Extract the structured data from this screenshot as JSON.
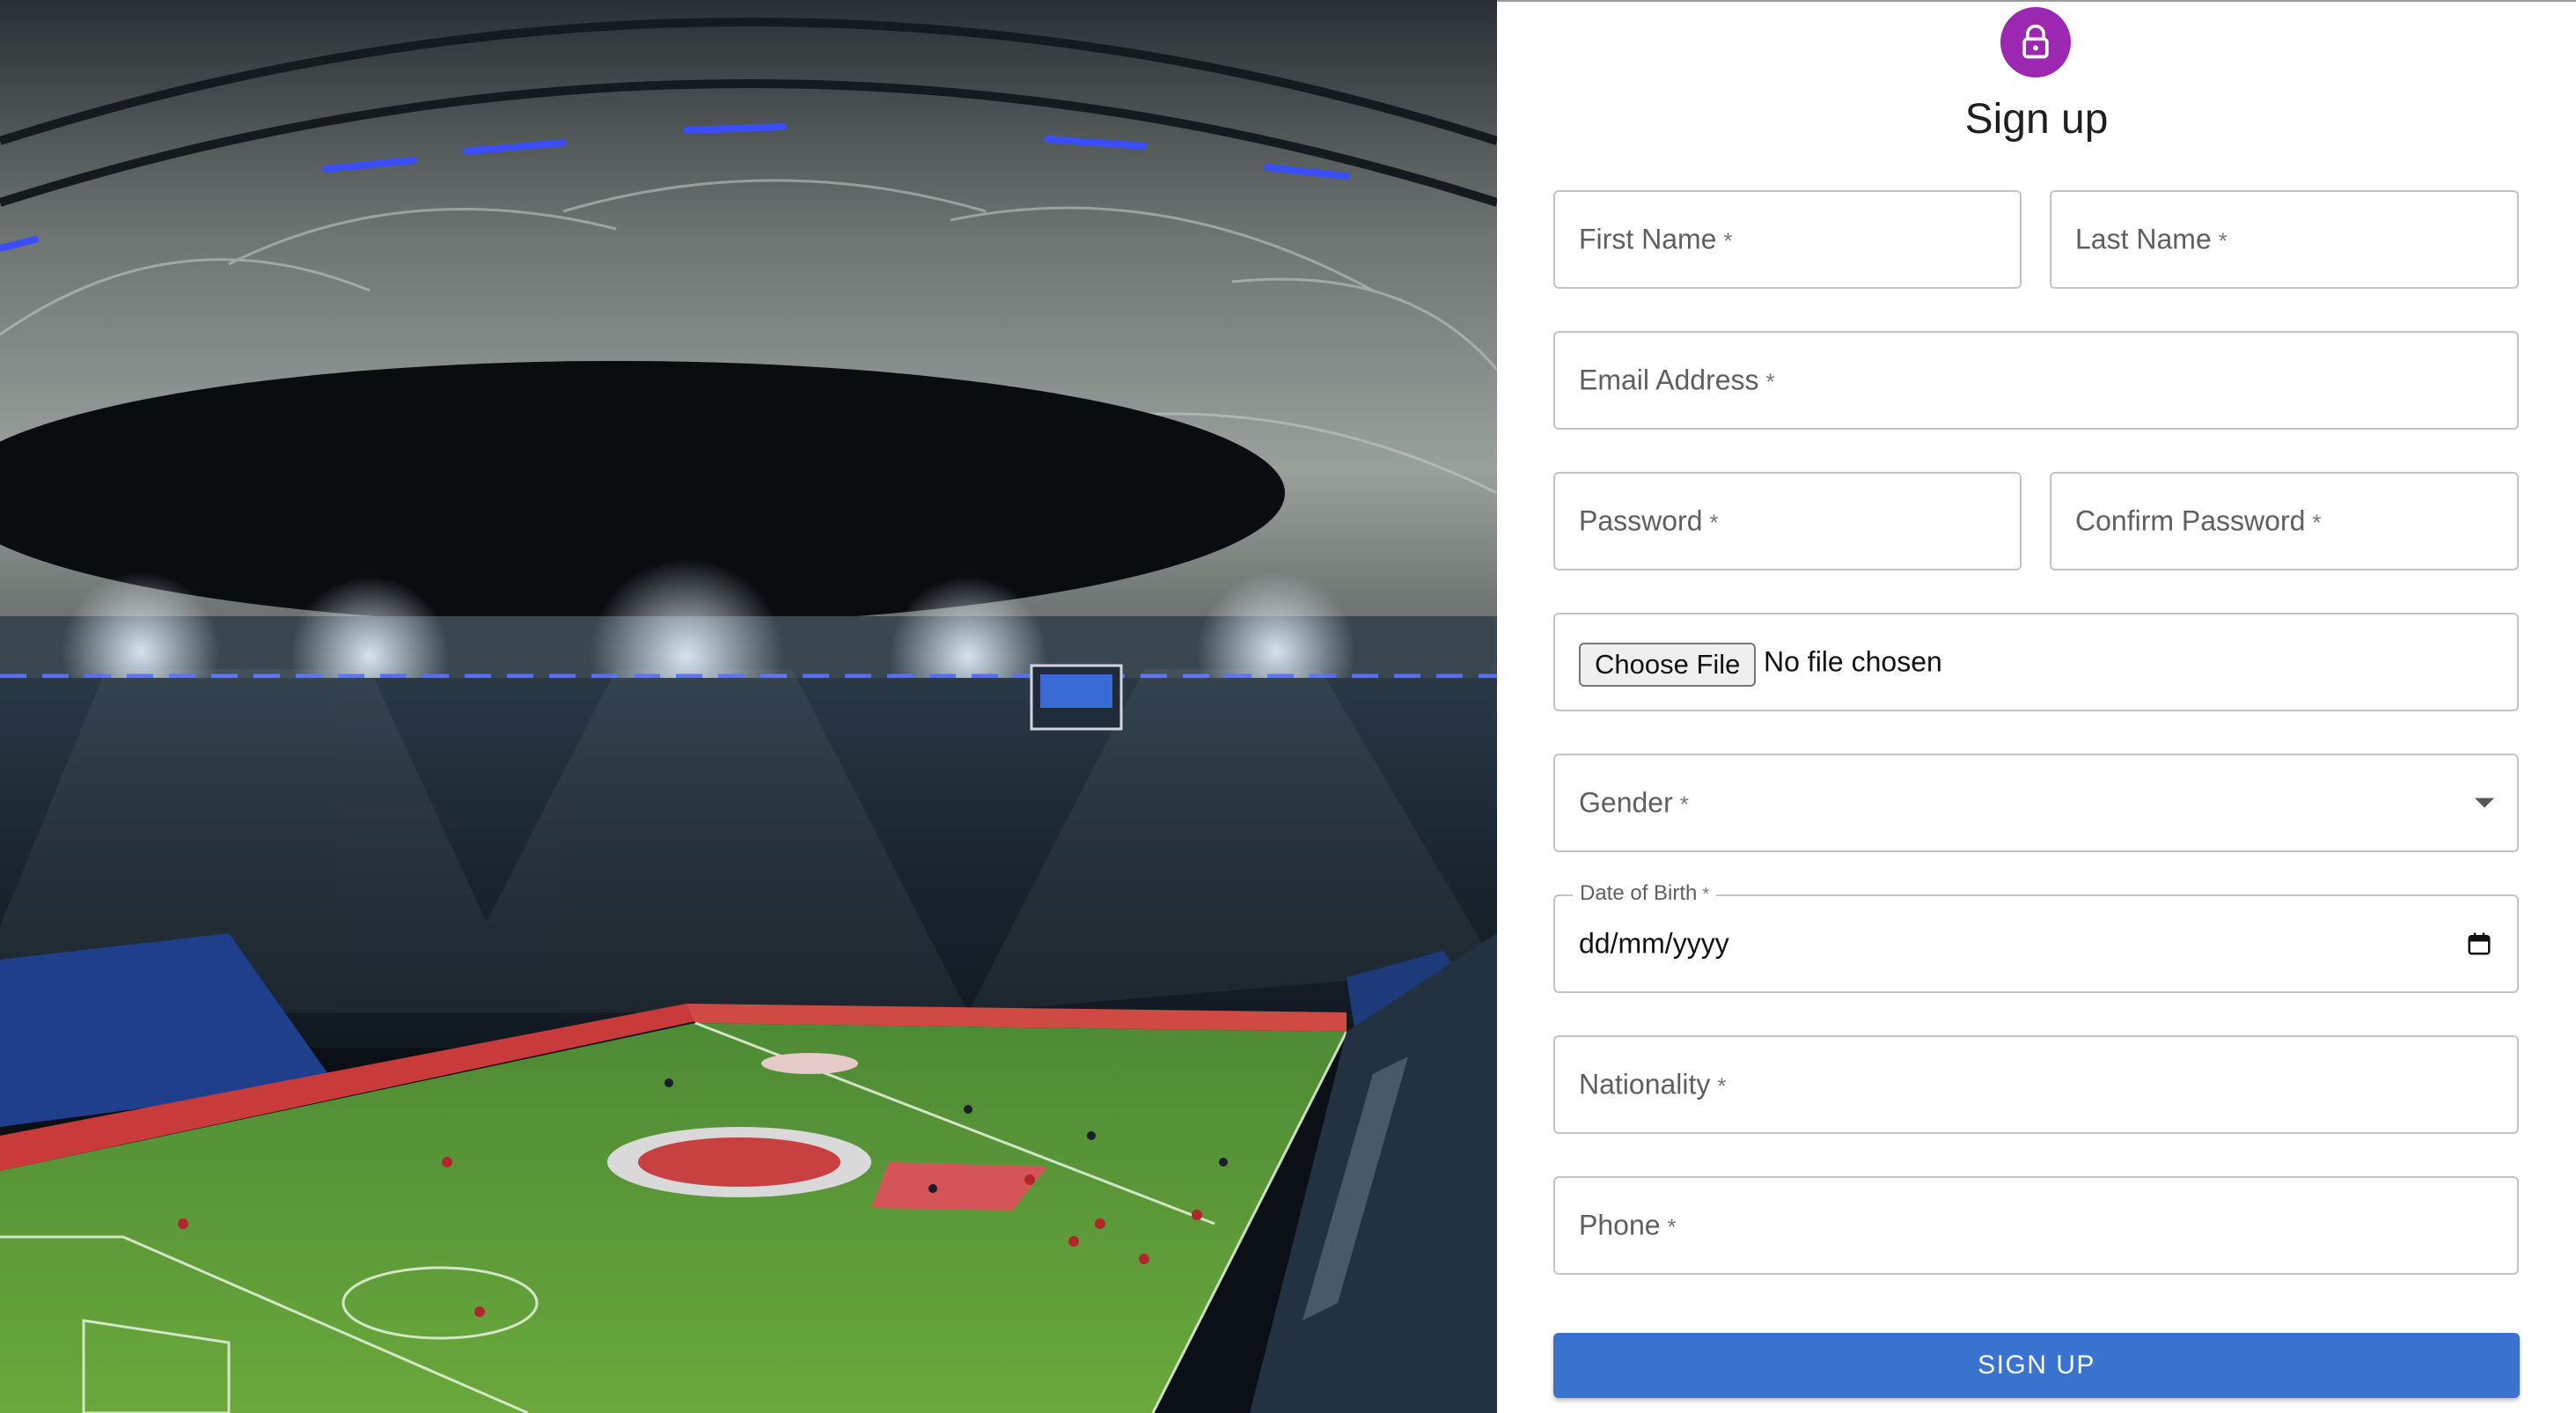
{
  "hero": {
    "image": "stadium-photo"
  },
  "form": {
    "icon": "lock-icon",
    "title": "Sign up",
    "required_marker": "*",
    "fields": {
      "first_name": "First Name",
      "last_name": "Last Name",
      "email": "Email Address",
      "password": "Password",
      "confirm_password": "Confirm Password",
      "gender": "Gender",
      "date_of_birth": "Date of Birth",
      "nationality": "Nationality",
      "phone": "Phone"
    },
    "file": {
      "button_label": "Choose File",
      "status": "No file chosen"
    },
    "date": {
      "placeholder": "dd/mm/yyyy"
    },
    "submit_label": "SIGN UP"
  },
  "colors": {
    "accent_purple": "#9c27b0",
    "primary_blue": "#3a73cf",
    "border_gray": "#c4c4c4"
  }
}
